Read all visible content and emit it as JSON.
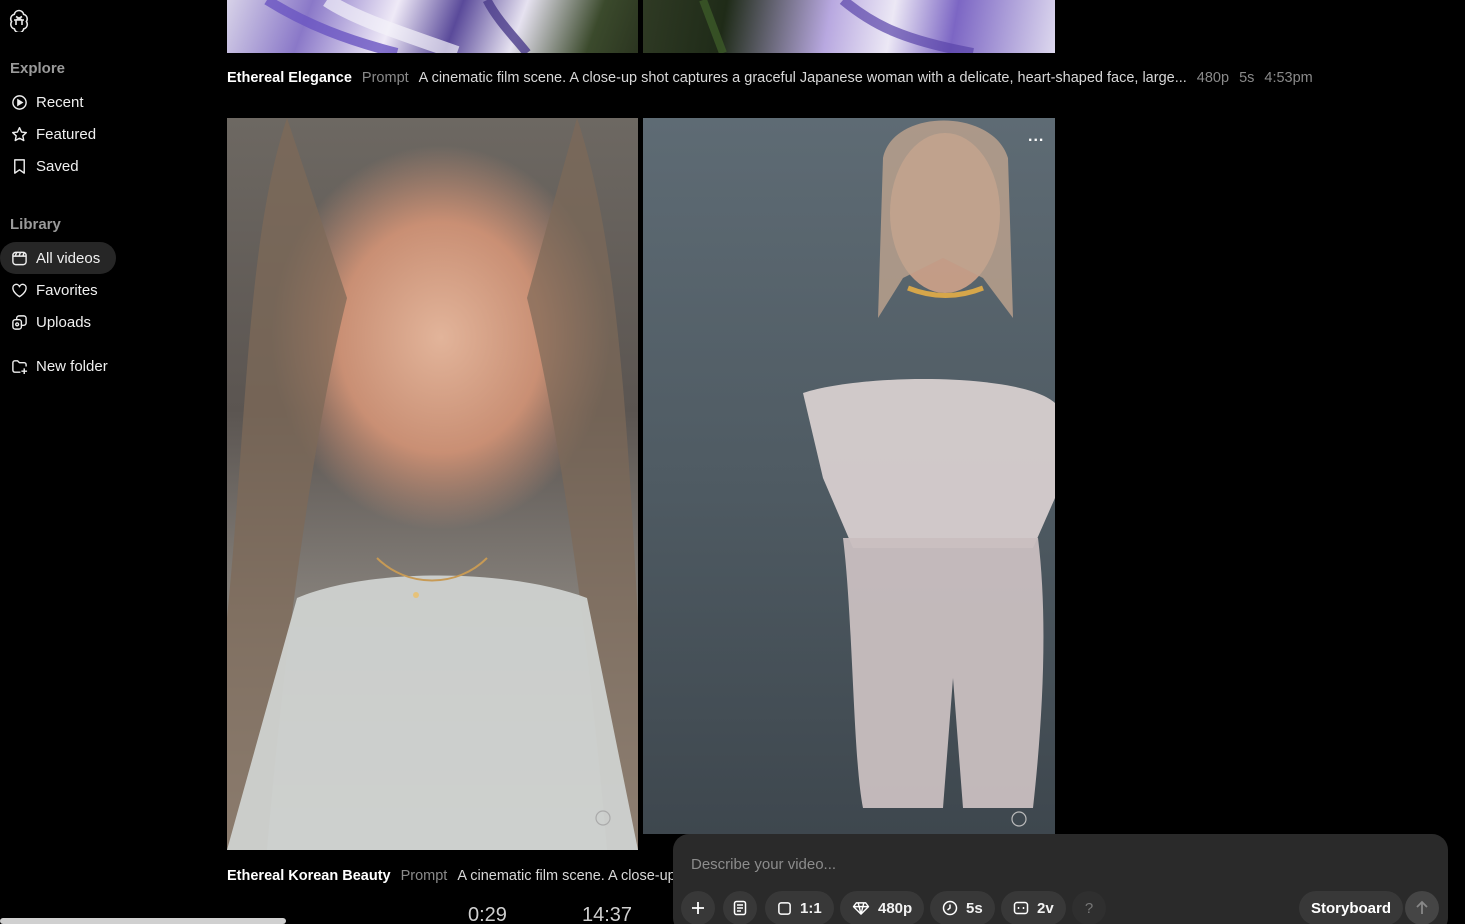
{
  "sidebar": {
    "explore_title": "Explore",
    "explore_items": [
      {
        "label": "Recent",
        "icon": "play-circle-icon"
      },
      {
        "label": "Featured",
        "icon": "star-icon"
      },
      {
        "label": "Saved",
        "icon": "bookmark-icon"
      }
    ],
    "library_title": "Library",
    "library_items": [
      {
        "label": "All videos",
        "icon": "film-icon",
        "active": true
      },
      {
        "label": "Favorites",
        "icon": "heart-icon"
      },
      {
        "label": "Uploads",
        "icon": "uploads-icon"
      }
    ],
    "new_folder_label": "New folder"
  },
  "feed": [
    {
      "title": "Ethereal Elegance",
      "prompt_label": "Prompt",
      "prompt": "A cinematic film scene. A close-up shot captures a graceful Japanese woman with a delicate, heart-shaped face, large...",
      "resolution": "480p",
      "duration": "5s",
      "time": "4:53pm"
    },
    {
      "title": "Ethereal Korean Beauty",
      "prompt_label": "Prompt",
      "prompt": "A cinematic film scene. A close-up"
    }
  ],
  "partial_numbers": [
    "0:29",
    "14:37"
  ],
  "more_label": "...",
  "composer": {
    "placeholder": "Describe your video...",
    "aspect": "1:1",
    "resolution": "480p",
    "duration": "5s",
    "variations": "2v",
    "help": "?",
    "storyboard": "Storyboard"
  },
  "colors": {
    "background": "#000000",
    "composer_bg": "#2a2a2a",
    "chip_bg": "#383838"
  }
}
